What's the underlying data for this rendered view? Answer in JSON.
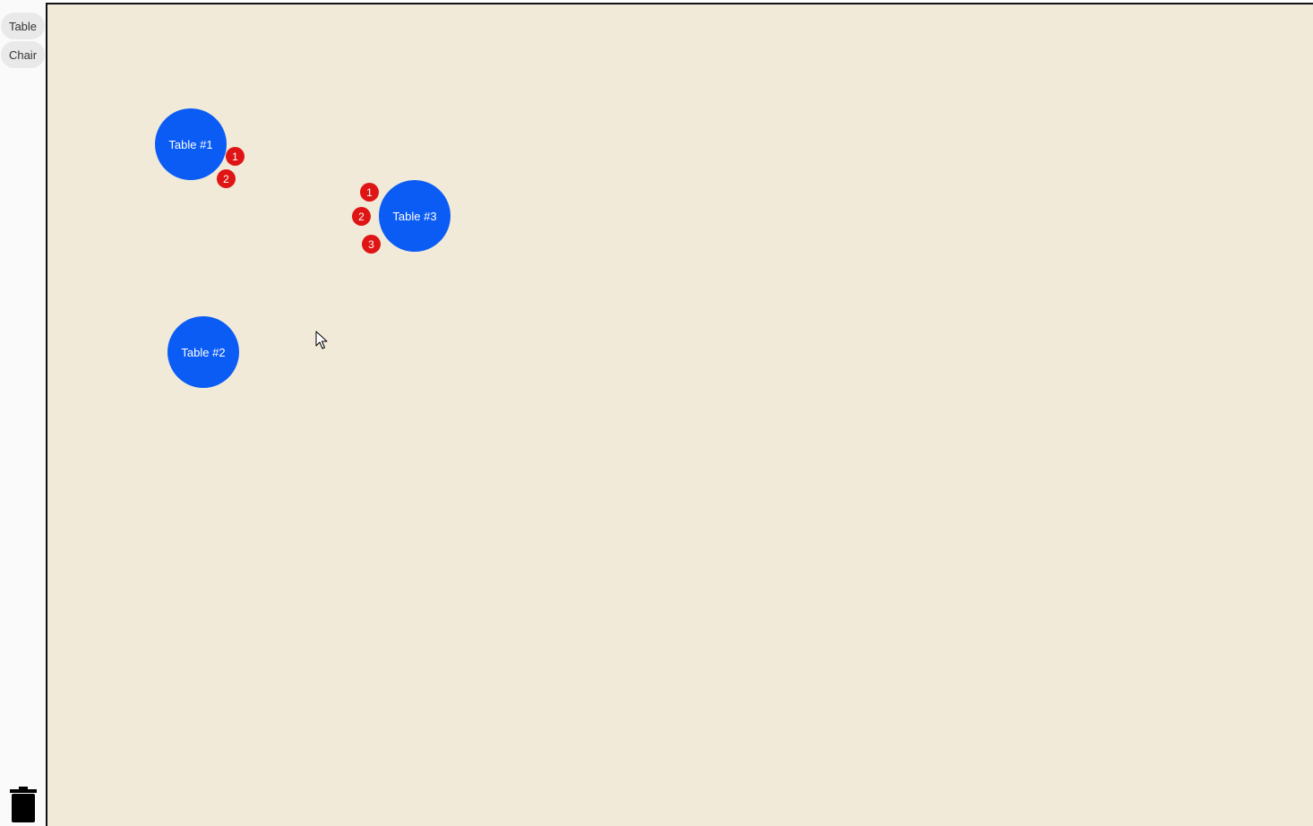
{
  "toolbar": {
    "table_label": "Table",
    "chair_label": "Chair",
    "trash_icon": "trash-icon"
  },
  "floor": {
    "background_color": "#f1ead9",
    "tables": [
      {
        "label": "Table #1",
        "chairs": [
          "1",
          "2"
        ]
      },
      {
        "label": "Table #2",
        "chairs": []
      },
      {
        "label": "Table #3",
        "chairs": [
          "1",
          "2",
          "3"
        ]
      }
    ]
  },
  "colors": {
    "table": "#0b5cf5",
    "chair": "#df1414"
  }
}
